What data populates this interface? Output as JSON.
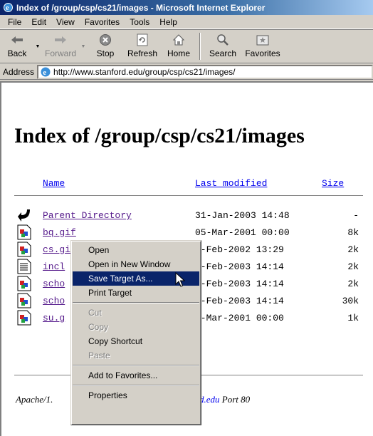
{
  "window": {
    "title": "Index of /group/csp/cs21/images - Microsoft Internet Explorer"
  },
  "menubar": {
    "items": [
      "File",
      "Edit",
      "View",
      "Favorites",
      "Tools",
      "Help"
    ]
  },
  "toolbar": {
    "back": "Back",
    "forward": "Forward",
    "stop": "Stop",
    "refresh": "Refresh",
    "home": "Home",
    "search": "Search",
    "favorites": "Favorites"
  },
  "address": {
    "label": "Address",
    "url": "http://www.stanford.edu/group/csp/cs21/images/"
  },
  "page": {
    "title": "Index of /group/csp/cs21/images",
    "columns": {
      "name": "Name",
      "modified": "Last modified",
      "size": "Size"
    },
    "rows": [
      {
        "name": "Parent Directory",
        "date": "31-Jan-2003 14:48",
        "size": "-",
        "icon": "parent-directory-icon"
      },
      {
        "name": "bq.gif",
        "date": "05-Mar-2001 00:00",
        "size": "8k",
        "icon": "image-file-icon"
      },
      {
        "name": "cs.gi",
        "date": "8-Feb-2002 13:29",
        "size": "2k",
        "icon": "image-file-icon"
      },
      {
        "name": "incl",
        "date": "4-Feb-2003 14:14",
        "size": "2k",
        "icon": "text-file-icon"
      },
      {
        "name": "scho",
        "date": "4-Feb-2003 14:14",
        "size": "2k",
        "icon": "image-file-icon"
      },
      {
        "name": "scho",
        "date": "4-Feb-2003 14:14",
        "size": "30k",
        "icon": "image-file-icon"
      },
      {
        "name": "su.g",
        "date": "5-Mar-2001 00:00",
        "size": "1k",
        "icon": "image-file-icon"
      }
    ],
    "footer": {
      "server": "Apache/1.",
      "host_link": "d.edu",
      "port": " Port 80"
    }
  },
  "context_menu": {
    "items": [
      {
        "label": "Open"
      },
      {
        "label": "Open in New Window"
      },
      {
        "label": "Save Target As..."
      },
      {
        "label": "Print Target"
      },
      {
        "label": "Cut"
      },
      {
        "label": "Copy"
      },
      {
        "label": "Copy Shortcut"
      },
      {
        "label": "Paste"
      },
      {
        "label": "Add to Favorites..."
      },
      {
        "label": "Properties"
      }
    ],
    "selected": "Save Target As..."
  },
  "colors": {
    "titlebar": "#0a246a",
    "selection": "#0a246a",
    "link": "#0000ee",
    "visited": "#551a8b",
    "chrome": "#d4d0c8"
  }
}
